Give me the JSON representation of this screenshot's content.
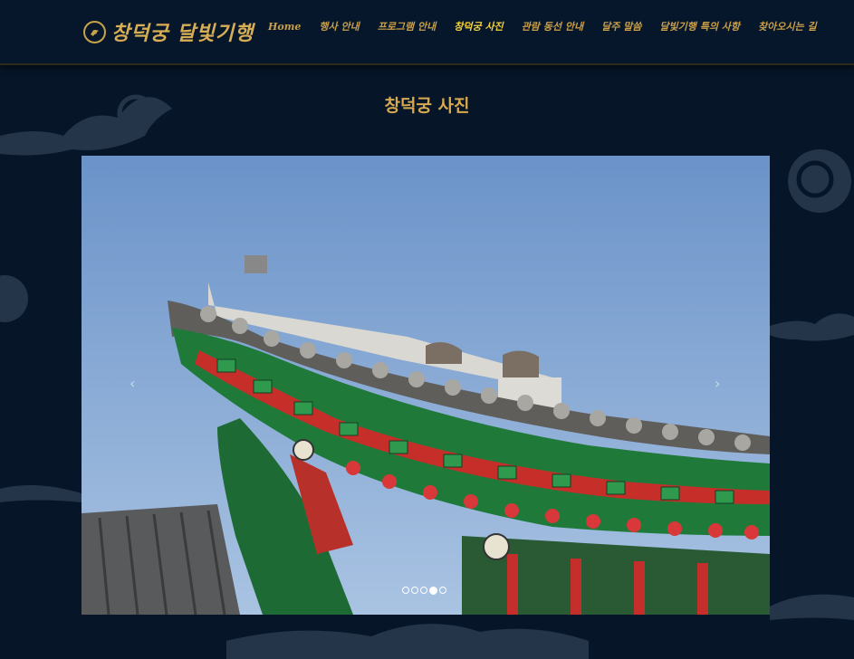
{
  "header": {
    "logo_text": "창덕궁 달빛기행",
    "nav": [
      {
        "label": "Home",
        "active": false
      },
      {
        "label": "행사 안내",
        "active": false
      },
      {
        "label": "프로그램 안내",
        "active": false
      },
      {
        "label": "창덕궁 사진",
        "active": true
      },
      {
        "label": "관람 동선 안내",
        "active": false
      },
      {
        "label": "달주 말씀",
        "active": false
      },
      {
        "label": "달빛기행 특의 사항",
        "active": false
      },
      {
        "label": "찾아오시는 길",
        "active": false
      }
    ]
  },
  "main": {
    "title": "창덕궁 사진"
  },
  "carousel": {
    "image_subject": "palace-eaves-photo",
    "prev_label": "‹",
    "next_label": "›",
    "slide_count": 5,
    "active_index": 3
  },
  "colors": {
    "background": "#061527",
    "accent": "#d7a950",
    "nav_active": "#f4d23a"
  }
}
